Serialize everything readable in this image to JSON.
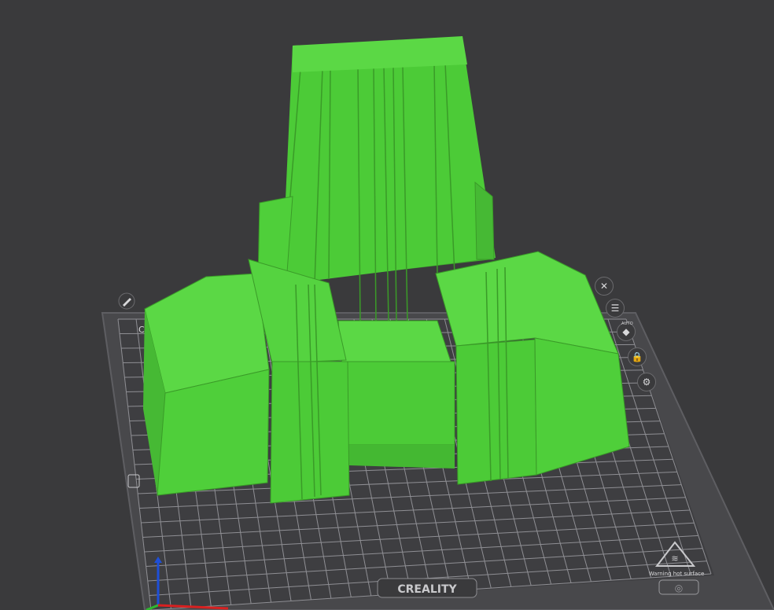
{
  "bed": {
    "brand_label": "CREALITY",
    "warning_label": "Warning hot surface",
    "corner_label": "C"
  },
  "tools": [
    {
      "name": "close",
      "icon": "close-icon"
    },
    {
      "name": "arrange",
      "icon": "arrange-list-icon"
    },
    {
      "name": "auto-orient",
      "icon": "auto-orient-icon",
      "label": "AUTO"
    },
    {
      "name": "lock",
      "icon": "lock-icon"
    },
    {
      "name": "settings",
      "icon": "gear-icon"
    }
  ],
  "colors": {
    "background": "#3a3a3c",
    "bed": "#4b4b4e",
    "grid": "#8c8c90",
    "model": "#4fcf3a",
    "model_shadow": "#3ea82c",
    "model_edge": "#6be654"
  }
}
